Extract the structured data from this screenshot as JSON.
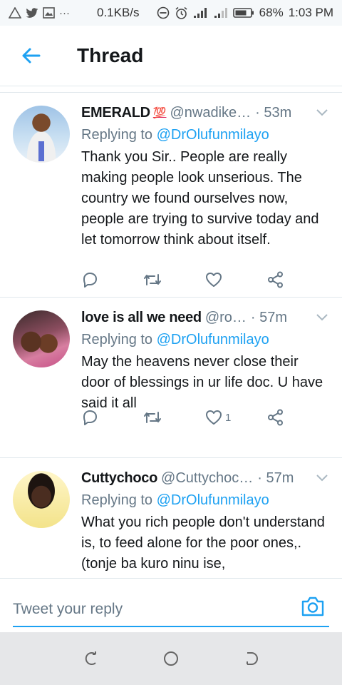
{
  "status_bar": {
    "left_icons": [
      "warning-icon",
      "twitter-icon",
      "gallery-icon",
      "more-icon"
    ],
    "more_glyph": "···",
    "network_speed": "0.1KB/s",
    "battery": "68%",
    "time": "1:03 PM"
  },
  "header": {
    "title": "Thread"
  },
  "colors": {
    "accent": "#1da1f2",
    "text_primary": "#14171a",
    "text_secondary": "#657786",
    "divider": "#e1e8ed",
    "nav_bar": "#e6e7e9"
  },
  "tweets": [
    {
      "author": "EMERALD",
      "author_emoji": "💯",
      "handle": "@nwadike…",
      "time": "· 53m",
      "replying_prefix": "Replying to ",
      "replying_to": "@DrOlufunmilayo",
      "text": "Thank you Sir.. People are really making people look unserious. The country we found ourselves now, people are trying to survive today and let tomorrow think about itself.",
      "likes": ""
    },
    {
      "author": "love is all we need",
      "handle": "@ro…",
      "time": "· 57m",
      "replying_prefix": "Replying to ",
      "replying_to": "@DrOlufunmilayo",
      "text": "May the heavens never close their door of blessings in ur life doc. U have said it all",
      "likes": "1"
    },
    {
      "author": "Cuttychoco",
      "handle": "@Cuttychoc…",
      "time": "· 57m",
      "replying_prefix": "Replying to ",
      "replying_to": "@DrOlufunmilayo",
      "text": "What you rich people don't understand is, to feed alone for the poor ones,.(tonje ba kuro ninu ise,"
    }
  ],
  "reply_bar": {
    "placeholder": "Tweet your reply"
  }
}
